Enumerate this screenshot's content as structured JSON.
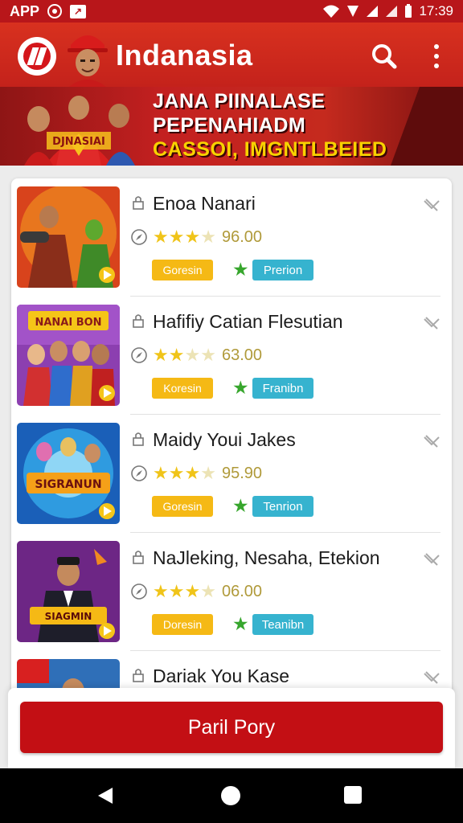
{
  "status_bar": {
    "label": "APP",
    "time": "17:39"
  },
  "header": {
    "title": "Indanasia",
    "search_icon": "search-icon",
    "menu_icon": "more-vert-icon"
  },
  "banner": {
    "lines": [
      "JANA PIINALASE",
      "PEPENAHIADM",
      "CASSOI, IMGNTLBEIED"
    ],
    "mascot_text": "DJNASIAI"
  },
  "colors": {
    "brand_red": "#c4221b",
    "button_red": "#c30f14",
    "tag_yellow": "#f5b915",
    "tag_blue": "#36b3cf",
    "star_gold": "#f0c419",
    "green_star": "#37a62d"
  },
  "list": {
    "items": [
      {
        "title": "Enoa Nanari",
        "stars_filled": 3,
        "rating": "96.00",
        "tag_primary": "Goresin",
        "tag_secondary": "Prerion",
        "thumb_text": ""
      },
      {
        "title": "Hafifiy Catian Flesutian",
        "stars_filled": 2,
        "rating": "63.00",
        "tag_primary": "Koresin",
        "tag_secondary": "Franibn",
        "thumb_text": "NANAI BON"
      },
      {
        "title": "Maidy Youi Jakes",
        "stars_filled": 3,
        "rating": "95.90",
        "tag_primary": "Goresin",
        "tag_secondary": "Tenrion",
        "thumb_text": "SIGRANUN"
      },
      {
        "title": "NaJleking, Nesaha, Etekion",
        "stars_filled": 3,
        "rating": "06.00",
        "tag_primary": "Doresin",
        "tag_secondary": "Teanibn",
        "thumb_text": "SIAGMIN"
      },
      {
        "title": "Dariak You Kase",
        "stars_filled": 0,
        "rating": "",
        "tag_primary": "",
        "tag_secondary": "",
        "thumb_text": ""
      }
    ]
  },
  "footer": {
    "primary_button": "Paril Pory"
  }
}
